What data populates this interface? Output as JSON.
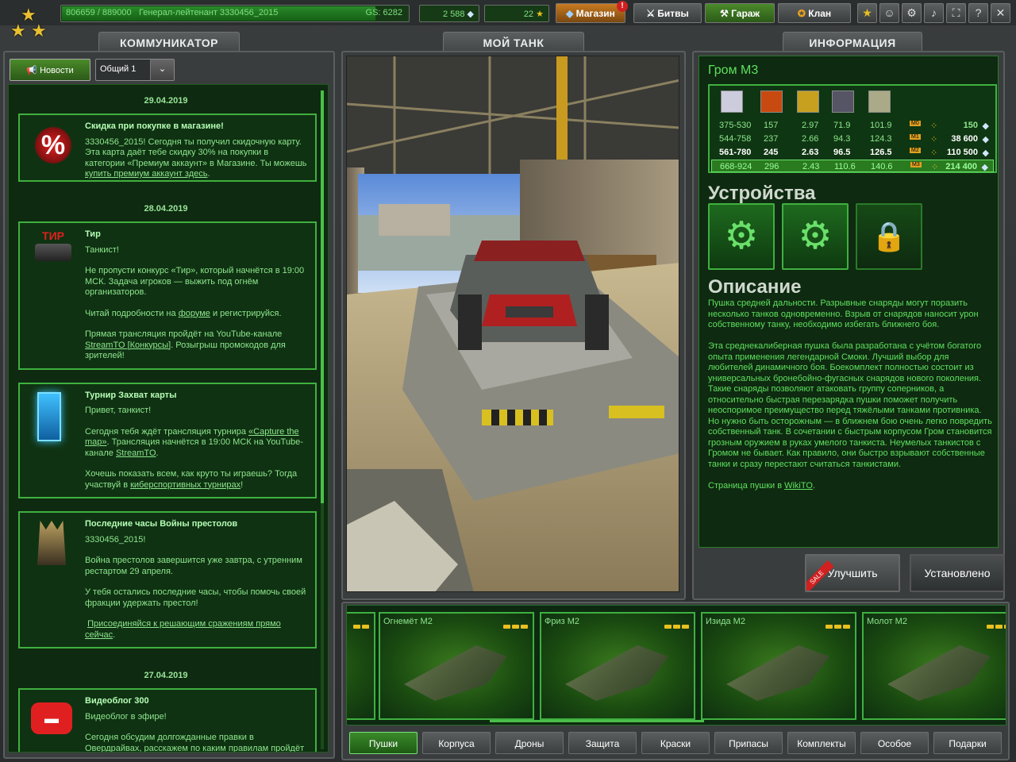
{
  "topbar": {
    "xp": "806659 / 889000",
    "xp_progress": 0.907,
    "rank_name": "Генерал-лейтенант 3330456_2015",
    "gs": "GS: 6282",
    "crystals": "2 588",
    "stars": "22",
    "shop_label": "Магазин",
    "shop_badge": "!",
    "battles_label": "Битвы",
    "garage_label": "Гараж",
    "clan_label": "Клан"
  },
  "tabs": {
    "communicator": "КОММУНИКАТОР",
    "my_tank": "МОЙ ТАНК",
    "info": "ИНФОРМАЦИЯ"
  },
  "communicator": {
    "news_button": "Новости",
    "channel_select": "Общий 1",
    "feed": [
      {
        "date": "29.04.2019",
        "items": [
          {
            "title": "Скидка при покупке в магазине!",
            "paragraphs": [
              "3330456_2015! Сегодня ты получил скидочную карту. Эта карта даёт тебе скидку 30% на покупки в категории «Премиум аккаунт» в Магазине. Ты можешь ",
              "купить премиум аккаунт здесь"
            ]
          }
        ]
      },
      {
        "date": "28.04.2019",
        "items": [
          {
            "title": "Тир",
            "icon_text": "ТИР"
          },
          {
            "title": "Турнир Захват карты"
          }
        ]
      },
      {
        "items": [
          {
            "title": "Последние часы Войны престолов"
          }
        ]
      },
      {
        "date": "27.04.2019",
        "items": [
          {
            "title": "Видеоблог 300"
          }
        ]
      }
    ],
    "tir": {
      "p1": "Танкист!",
      "p2": "Не пропусти конкурс «Тир», который начнётся в 19:00 МСК. Задача игроков — выжить под огнём организаторов.",
      "p3a": "Читай подробности на ",
      "p3link": "форуме",
      "p3b": " и регистрируйся.",
      "p4a": "Прямая трансляция пройдёт на YouTube-канале ",
      "p4link": "StreamTO [Конкурсы]",
      "p4b": ". Розыгрыш промокодов для зрителей!"
    },
    "tour": {
      "p1": "Привет, танкист!",
      "p2a": " Сегодня тебя ждёт трансляция турнира ",
      "p2link": "«Capture the map»",
      "p2b": ". Трансляция начнётся в 19:00 МСК на YouTube-канале ",
      "p2link2": "StreamTO",
      "p2c": ".",
      "p3a": "Хочешь показать всем, как круто ты играешь? Тогда участвуй в ",
      "p3link": "киберспортивных турнирах",
      "p3b": "!"
    },
    "thrones": {
      "p1": "3330456_2015!",
      "p2": "Война престолов завершится уже завтра, с утренним рестартом 29 апреля.",
      "p3": "У тебя остались последние часы, чтобы помочь своей фракции удержать престол!",
      "p4link": "Присоединяйся к решающим сражениям прямо сейчас",
      "p4b": "."
    },
    "vlog": {
      "p1": "Видеоблог в эфире!",
      "p2": "Сегодня обсудим долгожданные правки в Овердрайвах, расскажем по каким правилам пройдёт ближайшая Война и анонсируем Майские праздники. Приятного  просмотра!"
    }
  },
  "info": {
    "title": "Гром M3",
    "stats_rows": [
      {
        "c1": "375-530",
        "c2": "157",
        "c3": "2.97",
        "c4": "71.9",
        "c5": "101.9",
        "mod": "M0",
        "price": "150"
      },
      {
        "c1": "544-758",
        "c2": "237",
        "c3": "2.66",
        "c4": "94.3",
        "c5": "124.3",
        "mod": "M1",
        "price": "38 600"
      },
      {
        "c1": "561-780",
        "c2": "245",
        "c3": "2.63",
        "c4": "96.5",
        "c5": "126.5",
        "mod": "M2",
        "price": "110 500"
      },
      {
        "c1": "668-924",
        "c2": "296",
        "c3": "2.43",
        "c4": "110.6",
        "c5": "140.6",
        "mod": "M3",
        "price": "214 400"
      }
    ],
    "devices_title": "Устройства",
    "description_title": "Описание",
    "desc1": "Пушка средней дальности. Разрывные снаряды могут поразить несколько танков одновременно. Взрыв от снарядов наносит урон собственному танку, необходимо избегать ближнего боя.",
    "desc2": "Эта среднекалиберная пушка была разработана с учётом богатого опыта применения легендарной Смоки. Лучший выбор для любителей динамичного боя. Боекомплект полностью состоит из универсальных бронебойно-фугасных снарядов нового поколения. Такие снаряды позволяют атаковать группу соперников, а относительно быстрая перезарядка пушки поможет получить неоспоримое преимущество перед тяжёлыми танками противника. Но нужно быть осторожным — в ближнем бою очень легко повредить собственный танк. В сочетании с быстрым корпусом Гром становится грозным оружием в руках умелого танкиста. Неумелых танкистов с Громом не бывает. Как правило, они быстро взрывают собственные танки и сразу перестают считаться танкистами.",
    "wiki_a": "Страница пушки в ",
    "wiki_link": "WikiTO",
    "wiki_b": ".",
    "upgrade_label": "Улучшить",
    "sale_label": "SALE",
    "installed_label": "Установлено"
  },
  "items": [
    {
      "name": "Огнемёт M2"
    },
    {
      "name": "Фриз M2"
    },
    {
      "name": "Изида M2"
    },
    {
      "name": "Молот M2"
    }
  ],
  "categories": [
    "Пушки",
    "Корпуса",
    "Дроны",
    "Защита",
    "Краски",
    "Припасы",
    "Комплекты",
    "Особое",
    "Подарки"
  ],
  "colors": {
    "accent_green": "#3fb03f",
    "text_green": "#5fe05f",
    "gold": "#e8c020"
  }
}
